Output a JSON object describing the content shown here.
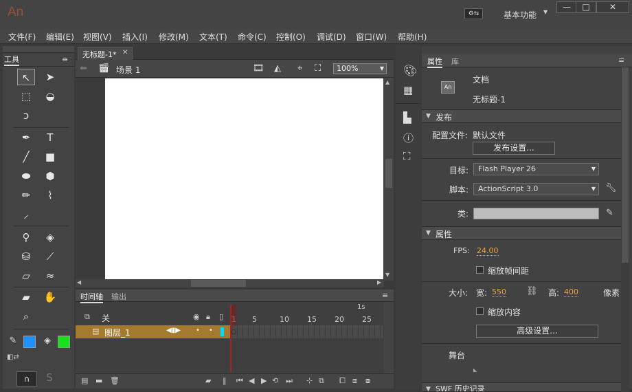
{
  "app": {
    "logo": "An",
    "workspace": "基本功能"
  },
  "window_buttons": {
    "min": "—",
    "max": "□",
    "close": "✕"
  },
  "menu": [
    "文件(F)",
    "编辑(E)",
    "视图(V)",
    "插入(I)",
    "修改(M)",
    "文本(T)",
    "命令(C)",
    "控制(O)",
    "调试(D)",
    "窗口(W)",
    "帮助(H)"
  ],
  "tools_panel": {
    "title": "工具"
  },
  "document": {
    "tab": "无标题-1*",
    "scene": "场景 1",
    "zoom": "100%"
  },
  "timeline": {
    "tabs": [
      "时间轴",
      "输出"
    ],
    "header_row": "关",
    "layer_name": "图层_1",
    "time_label": "1s",
    "frame_numbers": [
      "1",
      "5",
      "10",
      "15",
      "20",
      "25"
    ]
  },
  "properties": {
    "tabs": [
      "属性",
      "库"
    ],
    "doc_type": "文档",
    "doc_icon": "An",
    "doc_name": "无标题-1",
    "publish": {
      "section": "发布",
      "profile_label": "配置文件:",
      "profile_value": "默认文件",
      "settings_button": "发布设置...",
      "target_label": "目标:",
      "target_value": "Flash Player 26",
      "script_label": "脚本:",
      "script_value": "ActionScript 3.0",
      "class_label": "类:"
    },
    "attributes": {
      "section": "属性",
      "fps_label": "FPS:",
      "fps_value": "24.00",
      "scale_spans": "缩放帧间距",
      "size_label": "大小:",
      "width_label": "宽:",
      "width_value": "550",
      "height_label": "高:",
      "height_value": "400",
      "unit": "像素",
      "scale_content": "缩放内容",
      "advanced_button": "高级设置...",
      "stage_label": "舞台"
    },
    "swf_history": "SWF 历史记录"
  }
}
